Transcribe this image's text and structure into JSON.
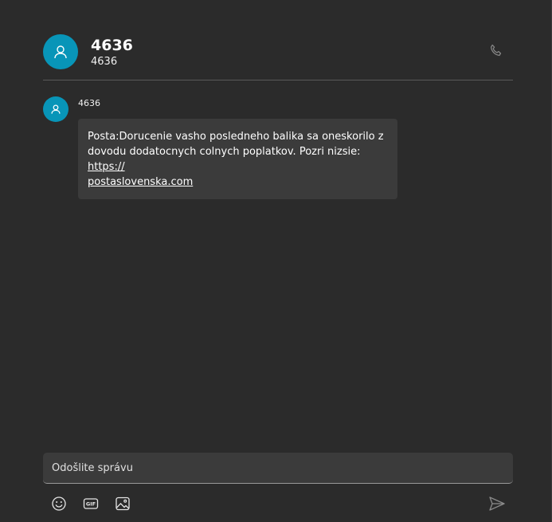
{
  "header": {
    "title": "4636",
    "subtitle": "4636",
    "avatar_icon": "person-icon",
    "call_icon": "phone-icon"
  },
  "messages": [
    {
      "sender": "4636",
      "text": "Posta:Dorucenie vasho posledneho balika sa oneskorilo z dovodu dodatocnych colnych poplatkov. Pozri nizsie: ",
      "link": "https://postaslovenska.com",
      "link_line1": "https://",
      "link_line2": "postaslovenska.com"
    }
  ],
  "composer": {
    "placeholder": "Odošlite správu",
    "value": ""
  },
  "toolbar": {
    "emoji_icon": "emoji-icon",
    "gif_icon": "gif-icon",
    "gif_label": "GIF",
    "image_icon": "image-icon",
    "send_icon": "send-icon"
  },
  "colors": {
    "background": "#2b2b2b",
    "bubble": "#3b3b3b",
    "avatar": "#0895b8",
    "divider": "#5a5a5a"
  }
}
